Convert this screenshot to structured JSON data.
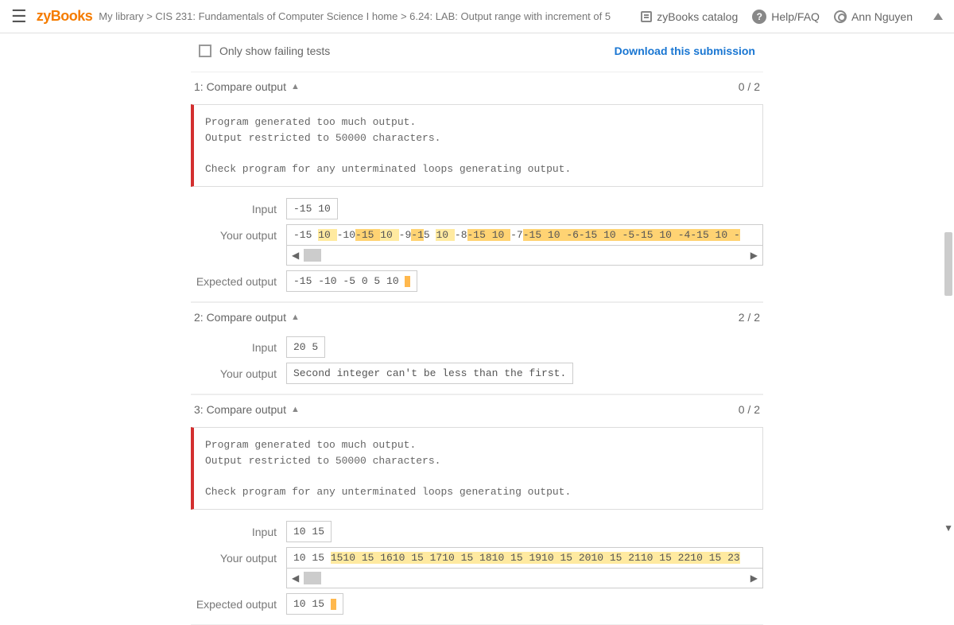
{
  "header": {
    "brand": "zyBooks",
    "breadcrumb": "My library > CIS 231: Fundamentals of Computer Science I home > 6.24: LAB: Output range with increment of 5",
    "catalog": "zyBooks catalog",
    "help": "Help/FAQ",
    "user": "Ann Nguyen"
  },
  "toprow": {
    "only_failing": "Only show failing tests",
    "download": "Download this submission"
  },
  "labels": {
    "input": "Input",
    "your_output": "Your output",
    "expected_output": "Expected output"
  },
  "warn": {
    "line1": "Program generated too much output.",
    "line2": "Output restricted to 50000 characters.",
    "line3": "Check program for any unterminated loops generating output."
  },
  "tests": [
    {
      "title": "1: Compare output",
      "score": "0 / 2",
      "has_warn": true,
      "input": "-15 10",
      "your_output_segments": [
        {
          "t": "-15 ",
          "c": ""
        },
        {
          "t": "10 ",
          "c": "diff1"
        },
        {
          "t": "-10",
          "c": ""
        },
        {
          "t": "-15 ",
          "c": "diff2"
        },
        {
          "t": "10 ",
          "c": "diff1"
        },
        {
          "t": "-9",
          "c": ""
        },
        {
          "t": "-1",
          "c": "diff2"
        },
        {
          "t": "5 ",
          "c": ""
        },
        {
          "t": "10 ",
          "c": "diff1"
        },
        {
          "t": "-8",
          "c": ""
        },
        {
          "t": "-15 10 ",
          "c": "diff2"
        },
        {
          "t": "-7",
          "c": ""
        },
        {
          "t": "-15 10 -6-15 10 -5-15 10 -4-15 10 -",
          "c": "diff2"
        }
      ],
      "has_scroll": true,
      "expected": "-15 -10 -5 0 5 10 ",
      "expected_nl": true,
      "simple_output": null
    },
    {
      "title": "2: Compare output",
      "score": "2 / 2",
      "has_warn": false,
      "input": "20 5",
      "your_output_segments": null,
      "has_scroll": false,
      "expected": null,
      "expected_nl": false,
      "simple_output": "Second integer can't be less than the first."
    },
    {
      "title": "3: Compare output",
      "score": "0 / 2",
      "has_warn": true,
      "input": "10 15",
      "your_output_segments": [
        {
          "t": "10 15 ",
          "c": ""
        },
        {
          "t": "1510 15 1610 15 1710 15 1810 15 1910 15 2010 15 2110 15 2210 15 23",
          "c": "diff1"
        }
      ],
      "has_scroll": true,
      "expected": "10 15 ",
      "expected_nl": true,
      "simple_output": null
    }
  ]
}
